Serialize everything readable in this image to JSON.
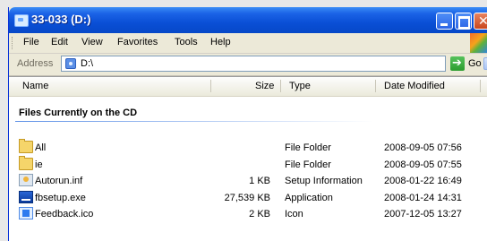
{
  "window": {
    "title": "33-033 (D:)"
  },
  "menu": [
    "File",
    "Edit",
    "View",
    "Favorites",
    "Tools",
    "Help"
  ],
  "address": {
    "label": "Address",
    "value": "D:\\",
    "go_label": "Go"
  },
  "columns": {
    "name": "Name",
    "size": "Size",
    "type": "Type",
    "date": "Date Modified"
  },
  "group": {
    "title": "Files Currently on the CD"
  },
  "files": [
    {
      "name": "All",
      "size": "",
      "type": "File Folder",
      "date": "2008-09-05 07:56",
      "icon": "folder-icon"
    },
    {
      "name": "ie",
      "size": "",
      "type": "File Folder",
      "date": "2008-09-05 07:55",
      "icon": "folder-icon"
    },
    {
      "name": "Autorun.inf",
      "size": "1 KB",
      "type": "Setup Information",
      "date": "2008-01-22 16:49",
      "icon": "setup-info-icon"
    },
    {
      "name": "fbsetup.exe",
      "size": "27,539 KB",
      "type": "Application",
      "date": "2008-01-24 14:31",
      "icon": "application-icon"
    },
    {
      "name": "Feedback.ico",
      "size": "2 KB",
      "type": "Icon",
      "date": "2007-12-05 13:27",
      "icon": "icon-file-icon"
    }
  ]
}
